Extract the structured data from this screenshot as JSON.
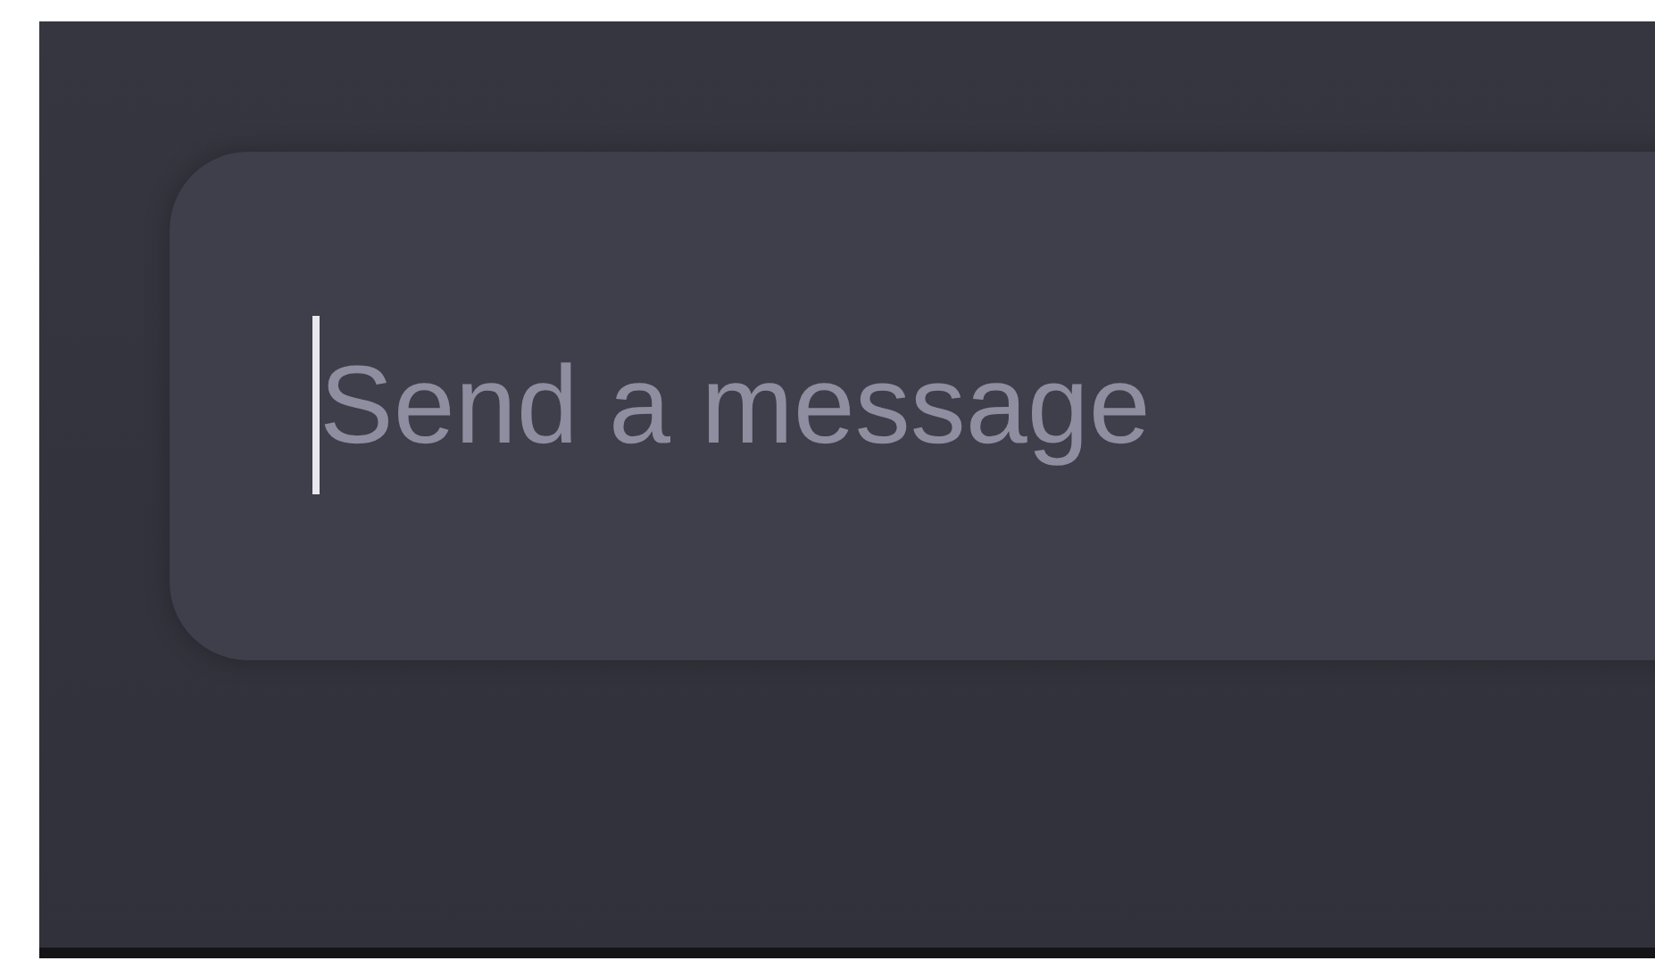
{
  "message_field": {
    "placeholder": "Send a message",
    "focused": true
  }
}
